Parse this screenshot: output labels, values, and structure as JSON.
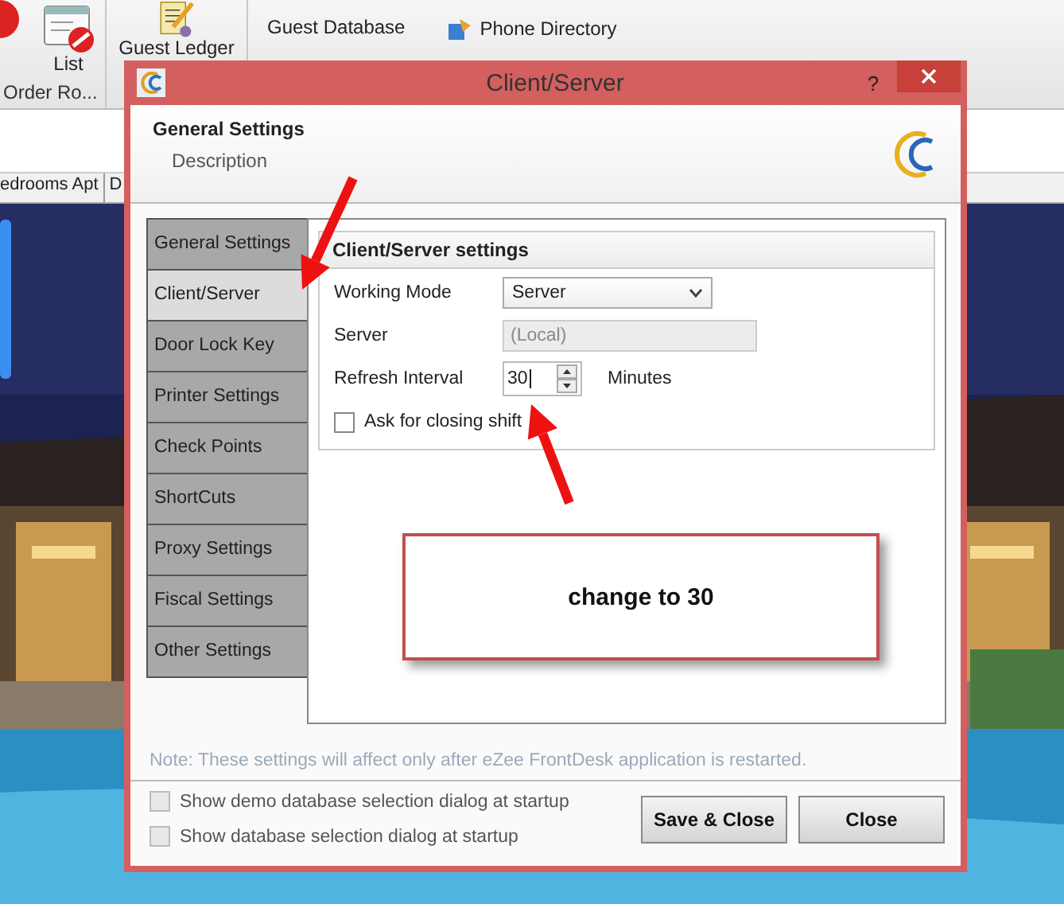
{
  "ribbon": {
    "buttons": [
      {
        "label": "List",
        "kind": "list"
      },
      {
        "label": "Guest Ledger",
        "kind": "ledger"
      }
    ],
    "group_label": "Order Ro...",
    "links": [
      {
        "label": "Guest Database",
        "kind": "plain"
      },
      {
        "label": "Phone Directory",
        "kind": "phone"
      }
    ]
  },
  "tabs": [
    {
      "label": "edrooms Apt"
    },
    {
      "label": "D"
    }
  ],
  "dialog": {
    "title": "Client/Server",
    "help": "?",
    "header": {
      "title": "General Settings",
      "description": "Description"
    },
    "nav": [
      {
        "label": "General Settings",
        "selected": false
      },
      {
        "label": "Client/Server",
        "selected": true
      },
      {
        "label": "Door Lock Key",
        "selected": false
      },
      {
        "label": "Printer Settings",
        "selected": false
      },
      {
        "label": "Check Points",
        "selected": false
      },
      {
        "label": "ShortCuts",
        "selected": false
      },
      {
        "label": "Proxy Settings",
        "selected": false
      },
      {
        "label": "Fiscal Settings",
        "selected": false
      },
      {
        "label": "Other Settings",
        "selected": false
      }
    ],
    "group_title": "Client/Server settings",
    "fields": [
      {
        "kind": "select",
        "label": "Working Mode",
        "value": "Server",
        "disabled": false
      },
      {
        "kind": "text",
        "label": "Server",
        "value": "(Local)",
        "disabled": true
      },
      {
        "kind": "spin",
        "label": "Refresh Interval",
        "value": "30",
        "unit": "Minutes",
        "disabled": false
      },
      {
        "kind": "check",
        "label": "Ask for closing shift",
        "checked": false,
        "disabled": false
      }
    ],
    "note": "Note: These settings will affect only after eZee FrontDesk application is restarted.",
    "startup_options": [
      {
        "label": "Show demo database selection dialog at startup",
        "checked": false,
        "disabled": true
      },
      {
        "label": "Show database selection dialog at startup",
        "checked": false,
        "disabled": true
      }
    ],
    "buttons": [
      "Save & Close",
      "Close"
    ]
  },
  "annotation": {
    "callout": "change to 30"
  }
}
